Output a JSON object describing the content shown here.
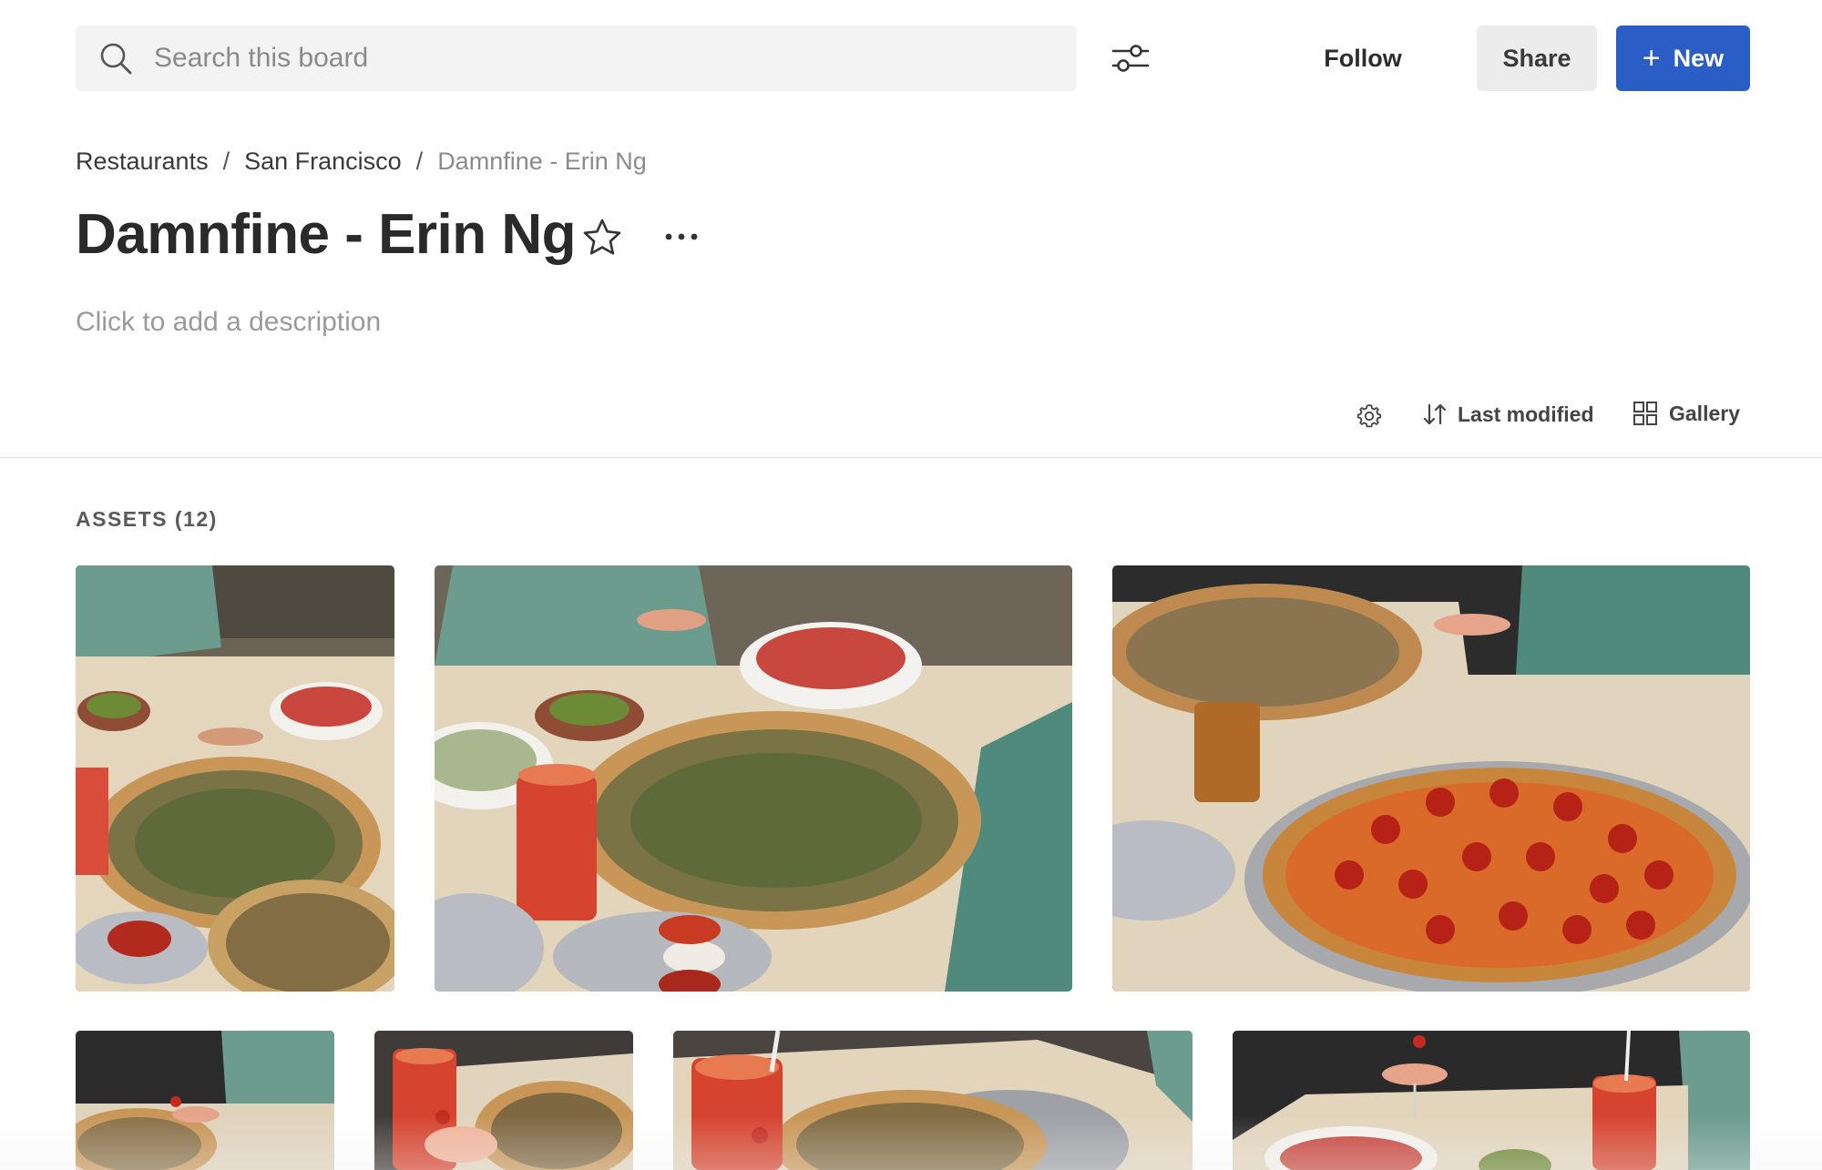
{
  "topbar": {
    "search_placeholder": "Search this board",
    "follow_label": "Follow",
    "share_label": "Share",
    "new_label": "New",
    "accent_color": "#2a5dc6"
  },
  "breadcrumb": {
    "items": [
      "Restaurants",
      "San Francisco"
    ],
    "separator": "/",
    "current": "Damnfine - Erin Ng"
  },
  "board": {
    "title": "Damnfine - Erin Ng",
    "description_placeholder": "Click to add a description"
  },
  "toolbar": {
    "sort_label": "Last modified",
    "view_label": "Gallery"
  },
  "assets": {
    "label": "ASSETS (12)",
    "visible_thumbnails": [
      "pizza-spread-close",
      "pizza-spread-wide",
      "pepperoni-pizza-table",
      "pizza-cocktail-chair",
      "cocktails-pizza",
      "grapefruit-cocktail-pizza",
      "salad-cocktails-table"
    ]
  },
  "icons": [
    "search-icon",
    "filter-sliders-icon",
    "plus-icon",
    "star-icon",
    "more-dots-icon",
    "gear-icon",
    "sort-arrows-icon",
    "grid-icon"
  ]
}
